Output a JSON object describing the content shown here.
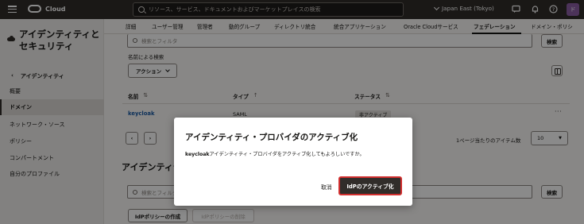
{
  "topbar": {
    "brand": "Cloud",
    "search_placeholder": "リソース、サービス、ドキュメントおよびマーケットプレイスの検索",
    "region": "Japan East (Tokyo)",
    "avatar_initial": "ド",
    "icons": [
      "menu-icon",
      "chevron-down-icon",
      "chat-icon",
      "bell-icon",
      "help-icon"
    ]
  },
  "sidebar": {
    "title": "アイデンティティとセキュリティ",
    "back_label": "アイデンティティ",
    "items": [
      {
        "label": "概要",
        "active": false
      },
      {
        "label": "ドメイン",
        "active": true
      },
      {
        "label": "ネットワーク・ソース",
        "active": false
      },
      {
        "label": "ポリシー",
        "active": false
      },
      {
        "label": "コンパートメント",
        "active": false
      },
      {
        "label": "自分のプロファイル",
        "active": false
      }
    ]
  },
  "tabs": [
    {
      "label": "詳細"
    },
    {
      "label": "ユーザー管理"
    },
    {
      "label": "管理者"
    },
    {
      "label": "動的グループ"
    },
    {
      "label": "ディレクトリ統合"
    },
    {
      "label": "統合アプリケーション"
    },
    {
      "label": "Oracle Cloudサービス"
    },
    {
      "label": "フェデレーション"
    },
    {
      "label": "ドメイン・ポリシ"
    }
  ],
  "idp_section": {
    "filter_placeholder": "検索とフィルタ",
    "search_button": "検索",
    "search_by_name": "名前による検索",
    "actions_label": "アクション",
    "columns": {
      "name": "名前",
      "type": "タイプ",
      "status": "ステータス"
    },
    "rows": [
      {
        "name": "keycloak",
        "type": "SAML",
        "status": "非アクティブ"
      }
    ],
    "page_size_label": "1ページ当たりのアイテム数",
    "page_size": "10"
  },
  "policy_section": {
    "title": "アイデンティティ",
    "filter_placeholder": "検索とフィルタ",
    "search_button": "検索",
    "create_button": "IdPポリシーの作成",
    "delete_button": "IdPポリシーの削除"
  },
  "dialog": {
    "title": "アイデンティティ・プロバイダのアクティブ化",
    "body_name": "keycloak",
    "body_text": "アイデンティティ・プロバイダをアクティブ化してもよろしいですか。",
    "cancel": "取消",
    "confirm": "IdPのアクティブ化"
  }
}
